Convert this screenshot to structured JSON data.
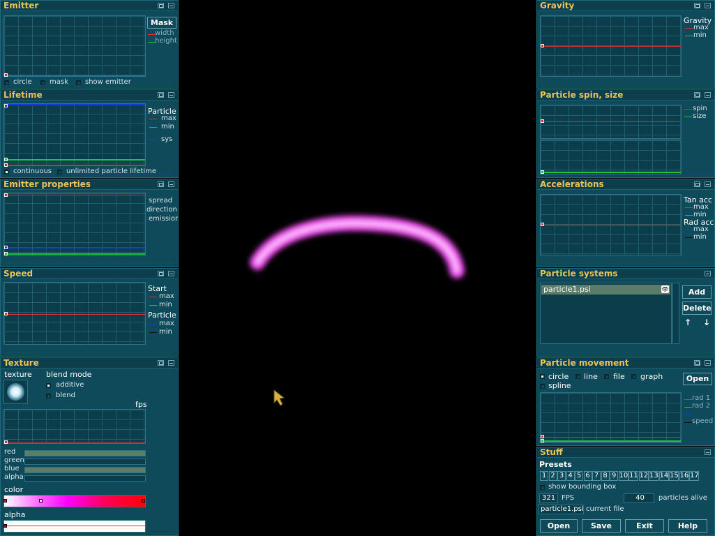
{
  "colors": {
    "panel": "#0f4a5a",
    "title": "#e8c25a",
    "red": "#d83030",
    "green": "#1fc43a",
    "blue": "#1c3cd8",
    "particle": "#ff66ff"
  },
  "emitter": {
    "title": "Emitter",
    "mask_label": "Mask",
    "width_label": "width",
    "height_label": "height",
    "circle_label": "circle",
    "mask_check_label": "mask",
    "show_emitter_label": "show emitter"
  },
  "lifetime": {
    "title": "Lifetime",
    "particle_label": "Particle",
    "max_label": "max",
    "min_label": "min",
    "sys_label": "sys",
    "continuous_label": "continuous",
    "unlimited_label": "unlimited particle lifetime"
  },
  "emitter_props": {
    "title": "Emitter properties",
    "spread_label": "spread",
    "direction_label": "direction",
    "emission_label": "emission"
  },
  "speed": {
    "title": "Speed",
    "start_label": "Start",
    "max_label": "max",
    "min_label": "min",
    "particle_label": "Particle",
    "pmax_label": "max",
    "pmin_label": "min"
  },
  "texture": {
    "title": "Texture",
    "texture_label": "texture",
    "blend_mode_label": "blend mode",
    "additive_label": "additive",
    "blend_label": "blend",
    "fps_label": "fps",
    "red_label": "red",
    "green_label": "green",
    "blue_label": "blue",
    "alpha_label": "alpha",
    "color_label": "color",
    "alpha2_label": "alpha",
    "red_value": 1.0,
    "green_value": 0.0,
    "blue_value": 1.0,
    "alpha_value": 0.0
  },
  "gravity": {
    "title": "Gravity",
    "gravity_label": "Gravity",
    "max_label": "max",
    "min_label": "min"
  },
  "spin_size": {
    "title": "Particle spin, size",
    "spin_label": "spin",
    "size_label": "size"
  },
  "accelerations": {
    "title": "Accelerations",
    "tan_label": "Tan acc",
    "tmax_label": "max",
    "tmin_label": "min",
    "rad_label": "Rad acc",
    "rmax_label": "max",
    "rmin_label": "min"
  },
  "systems": {
    "title": "Particle systems",
    "item": "particle1.psi",
    "add_label": "Add",
    "delete_label": "Delete",
    "up_icon": "↑",
    "down_icon": "↓",
    "eye_icon": "👁"
  },
  "movement": {
    "title": "Particle movement",
    "circle_label": "circle",
    "line_label": "line",
    "file_label": "file",
    "graph_label": "graph",
    "spline_label": "spline",
    "open_label": "Open",
    "rad1_label": "rad 1",
    "rad2_label": "rad 2",
    "speed_label": "speed"
  },
  "stuff": {
    "title": "Stuff",
    "presets_label": "Presets",
    "presets": [
      "1",
      "2",
      "3",
      "4",
      "5",
      "6",
      "7",
      "8",
      "9",
      "10",
      "11",
      "12",
      "13",
      "14",
      "15",
      "16",
      "17"
    ],
    "bbox_label": "show bounding box",
    "fps_value": "321",
    "fps_label": "FPS",
    "alive_value": "40",
    "alive_label": "particles alive",
    "file_value": "particle1.psi",
    "file_label": "current file",
    "open_label": "Open",
    "save_label": "Save",
    "exit_label": "Exit",
    "help_label": "Help"
  }
}
